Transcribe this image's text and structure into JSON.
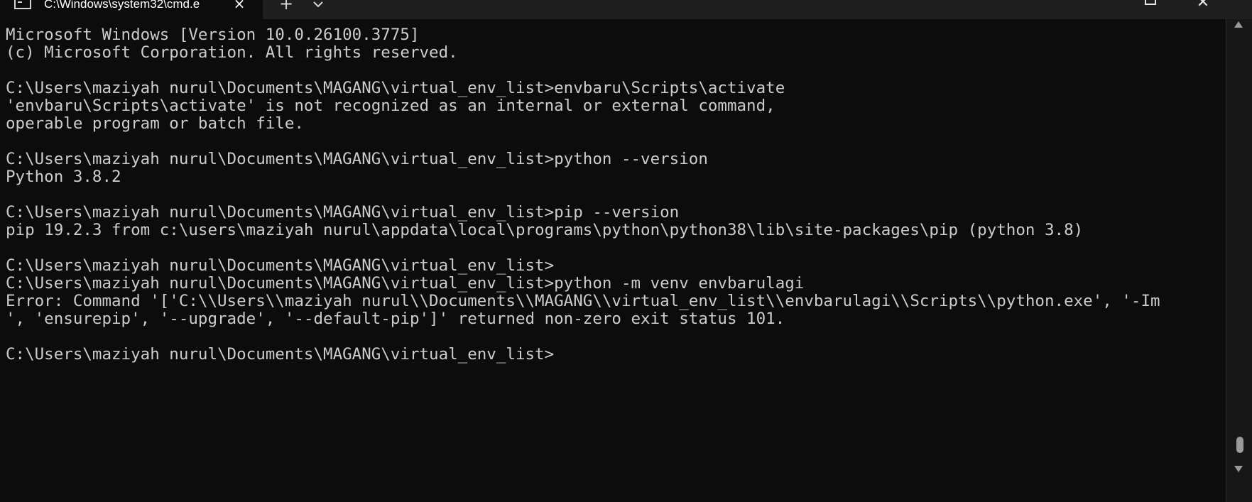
{
  "window": {
    "tab_title": "C:\\Windows\\system32\\cmd.e",
    "tab_icon": "terminal-icon",
    "tab_close": "×",
    "new_tab": "+",
    "dropdown_icon": "chevron-down-icon",
    "maximize_icon": "maximize-icon",
    "close_glyph": "✕"
  },
  "terminal": {
    "lines": [
      "Microsoft Windows [Version 10.0.26100.3775]",
      "(c) Microsoft Corporation. All rights reserved.",
      "",
      "C:\\Users\\maziyah nurul\\Documents\\MAGANG\\virtual_env_list>envbaru\\Scripts\\activate",
      "'envbaru\\Scripts\\activate' is not recognized as an internal or external command,",
      "operable program or batch file.",
      "",
      "C:\\Users\\maziyah nurul\\Documents\\MAGANG\\virtual_env_list>python --version",
      "Python 3.8.2",
      "",
      "C:\\Users\\maziyah nurul\\Documents\\MAGANG\\virtual_env_list>pip --version",
      "pip 19.2.3 from c:\\users\\maziyah nurul\\appdata\\local\\programs\\python\\python38\\lib\\site-packages\\pip (python 3.8)",
      "",
      "C:\\Users\\maziyah nurul\\Documents\\MAGANG\\virtual_env_list>",
      "C:\\Users\\maziyah nurul\\Documents\\MAGANG\\virtual_env_list>python -m venv envbarulagi",
      "Error: Command '['C:\\\\Users\\\\maziyah nurul\\\\Documents\\\\MAGANG\\\\virtual_env_list\\\\envbarulagi\\\\Scripts\\\\python.exe', '-Im",
      "', 'ensurepip', '--upgrade', '--default-pip']' returned non-zero exit status 101.",
      "",
      "C:\\Users\\maziyah nurul\\Documents\\MAGANG\\virtual_env_list>"
    ]
  },
  "scrollbar": {
    "up_icon": "arrow-up-icon",
    "down_icon": "arrow-down-icon"
  },
  "colors": {
    "background": "#0c0c0c",
    "text": "#cccccc",
    "titlebar": "#1f1f1f"
  }
}
